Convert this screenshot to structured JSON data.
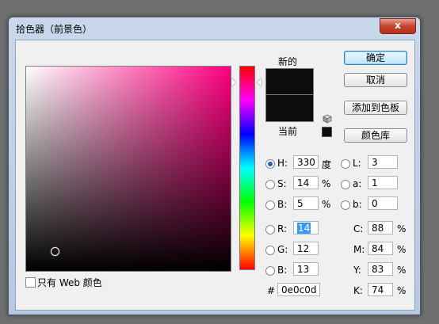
{
  "window": {
    "title": "拾色器（前景色）",
    "close_label": "x"
  },
  "color_hex": "#0e0c0d",
  "hue_indicator_fraction": 0.083,
  "sv_cursor": {
    "saturation": 14,
    "brightness": 5
  },
  "preview": {
    "new_label": "新的",
    "current_label": "当前"
  },
  "buttons": {
    "ok": "确定",
    "cancel": "取消",
    "add_swatch": "添加到色板",
    "libraries": "颜色库"
  },
  "hsb": [
    {
      "label": "H:",
      "value": "330",
      "unit": "度",
      "selected": true
    },
    {
      "label": "S:",
      "value": "14",
      "unit": "%",
      "selected": false
    },
    {
      "label": "B:",
      "value": "5",
      "unit": "%",
      "selected": false
    }
  ],
  "lab": [
    {
      "label": "L:",
      "value": "3"
    },
    {
      "label": "a:",
      "value": "1"
    },
    {
      "label": "b:",
      "value": "0"
    }
  ],
  "rgb": [
    {
      "label": "R:",
      "value": "14"
    },
    {
      "label": "G:",
      "value": "12"
    },
    {
      "label": "B:",
      "value": "13"
    }
  ],
  "cmyk": [
    {
      "label": "C:",
      "value": "88",
      "unit": "%"
    },
    {
      "label": "M:",
      "value": "84",
      "unit": "%"
    },
    {
      "label": "Y:",
      "value": "83",
      "unit": "%"
    },
    {
      "label": "K:",
      "value": "74",
      "unit": "%"
    }
  ],
  "hex": {
    "label": "#",
    "value": "0e0c0d"
  },
  "web_only": {
    "label": "只有 Web 颜色",
    "checked": false
  },
  "pure_hue_color": "#ff0080"
}
